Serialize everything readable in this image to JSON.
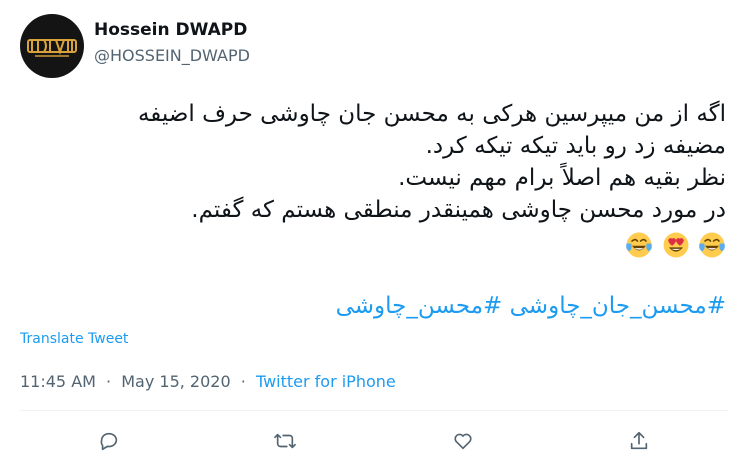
{
  "user": {
    "display_name": "Hossein DWAPD",
    "handle": "@HOSSEIN_DWAPD",
    "avatar_text": "DWAPD",
    "avatar_colors": {
      "background": "#141414",
      "logo": "#d9a23a"
    }
  },
  "tweet": {
    "lines": [
      "اگه از من میپرسین هرکی به محسن جان چاوشی حرف اضیفه",
      "مضیفه زد رو باید تیکه تیکه کرد.",
      "نظر بقیه هم اصلاً برام مهم نیست.",
      "در مورد محسن چاوشی همینقدر منطقی هستم که گفتم."
    ],
    "emojis": [
      "face-with-tears-of-joy",
      "smiling-face-with-heart-eyes",
      "face-with-tears-of-joy"
    ],
    "hashtags": [
      "#محسن_چاوشی",
      "#محسن_جان_چاوشی"
    ]
  },
  "translate_label": "Translate Tweet",
  "meta": {
    "time": "11:45 AM",
    "separator": "·",
    "date": "May 15, 2020",
    "source": "Twitter for iPhone"
  },
  "actions": [
    {
      "name": "reply",
      "icon": "reply-icon"
    },
    {
      "name": "retweet",
      "icon": "retweet-icon"
    },
    {
      "name": "like",
      "icon": "heart-icon"
    },
    {
      "name": "share",
      "icon": "share-icon"
    }
  ],
  "colors": {
    "text": "#0f1419",
    "secondary": "#536471",
    "accent": "#1d9bf0",
    "divider": "#eff3f4"
  }
}
